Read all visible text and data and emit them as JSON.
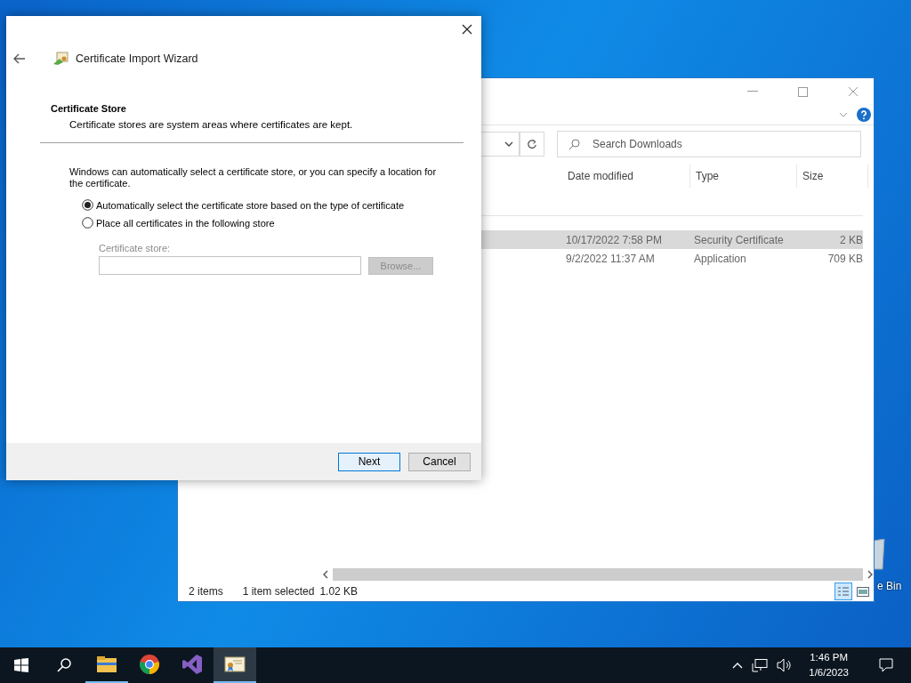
{
  "wizard": {
    "title": "Certificate Import Wizard",
    "heading": "Certificate Store",
    "subheading": "Certificate stores are system areas where certificates are kept.",
    "intro": "Windows can automatically select a certificate store, or you can specify a location for the certificate.",
    "options": [
      {
        "label": "Automatically select the certificate store based on the type of certificate",
        "selected": true
      },
      {
        "label": "Place all certificates in the following store",
        "selected": false
      }
    ],
    "store_label": "Certificate store:",
    "store_disabled": true,
    "browse_button": "Browse...",
    "buttons": [
      {
        "label": "Next",
        "focused": true
      },
      {
        "label": "Cancel",
        "focused": false
      }
    ]
  },
  "explorer": {
    "search": {
      "placeholder": "Search Downloads"
    },
    "columns": [
      "Date modified",
      "Type",
      "Size"
    ],
    "rows": [
      {
        "date": "10/17/2022 7:58 PM",
        "type": "Security Certificate",
        "size": "2 KB",
        "selected": true
      },
      {
        "date": "9/2/2022 11:37 AM",
        "type": "Application",
        "size": "709 KB",
        "selected": false
      }
    ],
    "status": [
      "2 items",
      "1 item selected",
      "1.02 KB"
    ]
  },
  "desktop_icons": [
    {
      "label": "e Bin"
    }
  ],
  "taskbar": {
    "apps": [
      {
        "kind": "folder",
        "running": true,
        "selected": false
      },
      {
        "kind": "browser",
        "running": false,
        "selected": false
      },
      {
        "kind": "studio",
        "running": false,
        "selected": false
      },
      {
        "kind": "certificate",
        "running": true,
        "selected": true
      }
    ],
    "time": "1:46 PM",
    "date": "1/6/2023"
  }
}
